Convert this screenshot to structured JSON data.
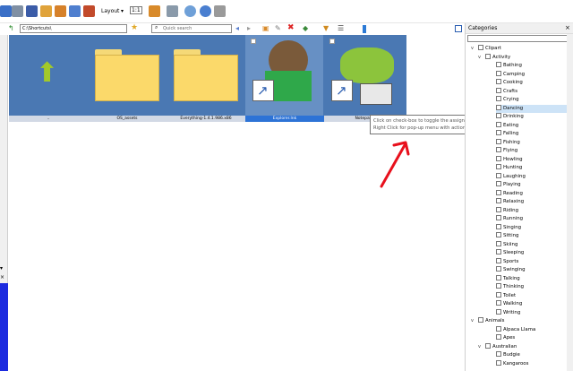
{
  "toolbar": {
    "layout_label": "Layout",
    "view_label": "1:1"
  },
  "address": {
    "value": "C:\\Shortcuts\\"
  },
  "search": {
    "placeholder": "Quick search"
  },
  "thumbnails": [
    {
      "name": "..",
      "kind": "up",
      "selected": false
    },
    {
      "name": "OS_assets",
      "kind": "folder",
      "selected": false
    },
    {
      "name": "Everything-1.4.1.986.x86",
      "kind": "folder",
      "selected": false
    },
    {
      "name": "Explorer.lnk",
      "kind": "shortcut",
      "selected": true
    },
    {
      "name": "Notepad",
      "kind": "shortcut",
      "selected": false
    }
  ],
  "tooltip": {
    "line1": "Click on check-box to toggle the assignment",
    "line2": "Right Click for pop-up menu with actions"
  },
  "categories": {
    "title": "Categories",
    "items": [
      {
        "label": "Clipart",
        "level": 0,
        "exp": "v"
      },
      {
        "label": "Activity",
        "level": 1,
        "exp": "v"
      },
      {
        "label": "Bathing",
        "level": 2
      },
      {
        "label": "Camping",
        "level": 2
      },
      {
        "label": "Cooking",
        "level": 2
      },
      {
        "label": "Crafts",
        "level": 2
      },
      {
        "label": "Crying",
        "level": 2
      },
      {
        "label": "Dancing",
        "level": 2,
        "highlight": true
      },
      {
        "label": "Drinking",
        "level": 2
      },
      {
        "label": "Eating",
        "level": 2
      },
      {
        "label": "Falling",
        "level": 2
      },
      {
        "label": "Fishing",
        "level": 2
      },
      {
        "label": "Flying",
        "level": 2
      },
      {
        "label": "Howling",
        "level": 2
      },
      {
        "label": "Hunting",
        "level": 2
      },
      {
        "label": "Laughing",
        "level": 2
      },
      {
        "label": "Playing",
        "level": 2
      },
      {
        "label": "Reading",
        "level": 2
      },
      {
        "label": "Relaxing",
        "level": 2
      },
      {
        "label": "Riding",
        "level": 2
      },
      {
        "label": "Running",
        "level": 2
      },
      {
        "label": "Singing",
        "level": 2
      },
      {
        "label": "Sitting",
        "level": 2
      },
      {
        "label": "Skiing",
        "level": 2
      },
      {
        "label": "Sleeping",
        "level": 2
      },
      {
        "label": "Sports",
        "level": 2
      },
      {
        "label": "Swinging",
        "level": 2
      },
      {
        "label": "Talking",
        "level": 2
      },
      {
        "label": "Thinking",
        "level": 2
      },
      {
        "label": "Toilet",
        "level": 2
      },
      {
        "label": "Walking",
        "level": 2
      },
      {
        "label": "Writing",
        "level": 2
      },
      {
        "label": "Animals",
        "level": 0,
        "exp": "v"
      },
      {
        "label": "Alpaca Llama",
        "level": 2
      },
      {
        "label": "Apes",
        "level": 2
      },
      {
        "label": "Australian",
        "level": 1,
        "exp": "v"
      },
      {
        "label": "Budgie",
        "level": 2
      },
      {
        "label": "Kangaroos",
        "level": 2
      }
    ]
  },
  "colors": {
    "thumb_bg": "#4a78b3",
    "selected_caption": "#2d73d6",
    "arrow": "#e8101c",
    "left_accent": "#1c2bdf"
  }
}
